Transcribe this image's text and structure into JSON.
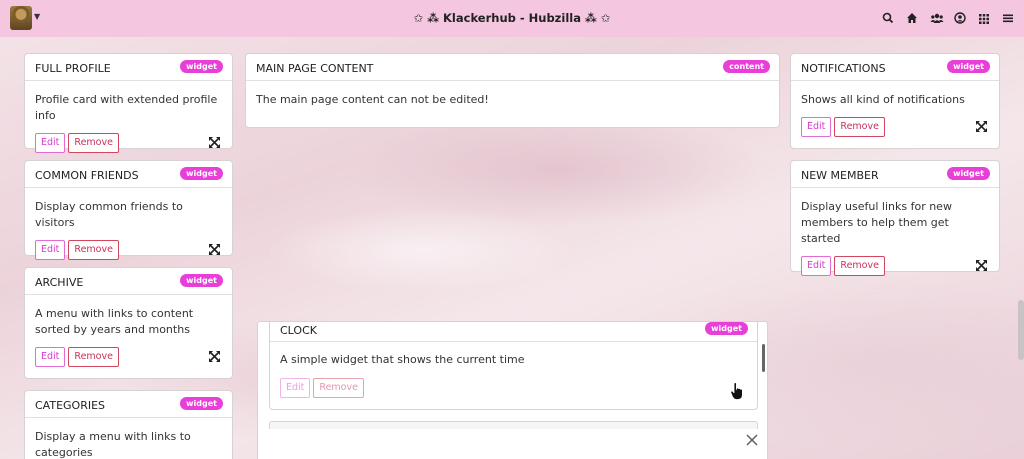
{
  "header": {
    "title": "✩ ⁂ Klackerhub - Hubzilla ⁂ ✩",
    "avatar_icon": "avatar-icon",
    "icons": [
      "search-icon",
      "home-icon",
      "users-icon",
      "user-circle-icon",
      "apps-grid-icon",
      "menu-icon"
    ]
  },
  "colors": {
    "navbar": "#f4c6e0",
    "badge": "#e83fd9",
    "remove_border": "#d0475f",
    "edit_border": "#e36bd6"
  },
  "buttons": {
    "edit": "Edit",
    "remove": "Remove"
  },
  "left_column": [
    {
      "title": "FULL PROFILE",
      "badge": "widget",
      "description": "Profile card with extended profile info"
    },
    {
      "title": "COMMON FRIENDS",
      "badge": "widget",
      "description": "Display common friends to visitors"
    },
    {
      "title": "ARCHIVE",
      "badge": "widget",
      "description": "A menu with links to content sorted by years and months"
    },
    {
      "title": "CATEGORIES",
      "badge": "widget",
      "description": "Display a menu with links to categories"
    }
  ],
  "main": {
    "title": "MAIN PAGE CONTENT",
    "badge": "content",
    "description": "The main page content can not be edited!"
  },
  "right_column": [
    {
      "title": "NOTIFICATIONS",
      "badge": "widget",
      "description": "Shows all kind of notifications"
    },
    {
      "title": "NEW MEMBER",
      "badge": "widget",
      "description": "Display useful links for new members to help them get started"
    }
  ],
  "dragging": {
    "title": "CLOCK",
    "badge": "widget",
    "description": "A simple widget that shows the current time"
  }
}
